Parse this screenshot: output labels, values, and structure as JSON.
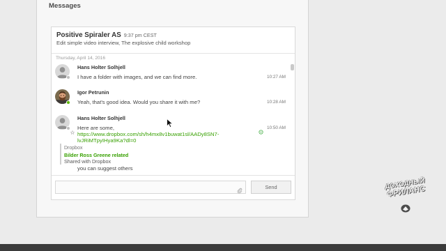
{
  "page": {
    "title": "Messages"
  },
  "thread": {
    "name": "Positive Spiraler AS",
    "time": "9:37 pm CEST",
    "subtitle": "Edit simple video interview, The explosive child workshop"
  },
  "date_separator": "Thursday, April 14, 2016",
  "messages": [
    {
      "sender": "Hans Holter Solhjell",
      "avatar_icon": "default-user-icon",
      "online": false,
      "text": "I have a folder with images, and we can find more.",
      "time": "10:27 AM"
    },
    {
      "sender": "Igor Petrunin",
      "avatar_icon": "user-photo",
      "online": true,
      "text": "Yeah, that's good idea. Would you share it with me?",
      "time": "10:28 AM"
    },
    {
      "sender": "Hans Holter Solhjell",
      "avatar_icon": "default-user-icon",
      "online": false,
      "text": "Here are some,",
      "link_lines": [
        "https://www.dropbox.com/sh/h4mx8v1buwat1sl/AADy8SN7-",
        "lvJRiMTpyIHya9Ka?dl=0"
      ],
      "time": "10:50 AM",
      "status_icon": "clock-icon",
      "attachment": {
        "source": "Dropbox",
        "title": "Bilder Ross Greene related",
        "description": "Shared with Dropbox"
      },
      "followup_text": "you can suggest others"
    }
  ],
  "composer": {
    "attach_icon": "paperclip-icon",
    "send_label": "Send"
  },
  "watermark": {
    "line1": "ДОХОДНЫЙ",
    "line2": "ФРИЛАНС"
  },
  "colors": {
    "link": "#37a000",
    "online": "#5cb800",
    "offline": "#bdbdbd",
    "text": "#333333",
    "bottom_bar": "#3b3b3b"
  }
}
